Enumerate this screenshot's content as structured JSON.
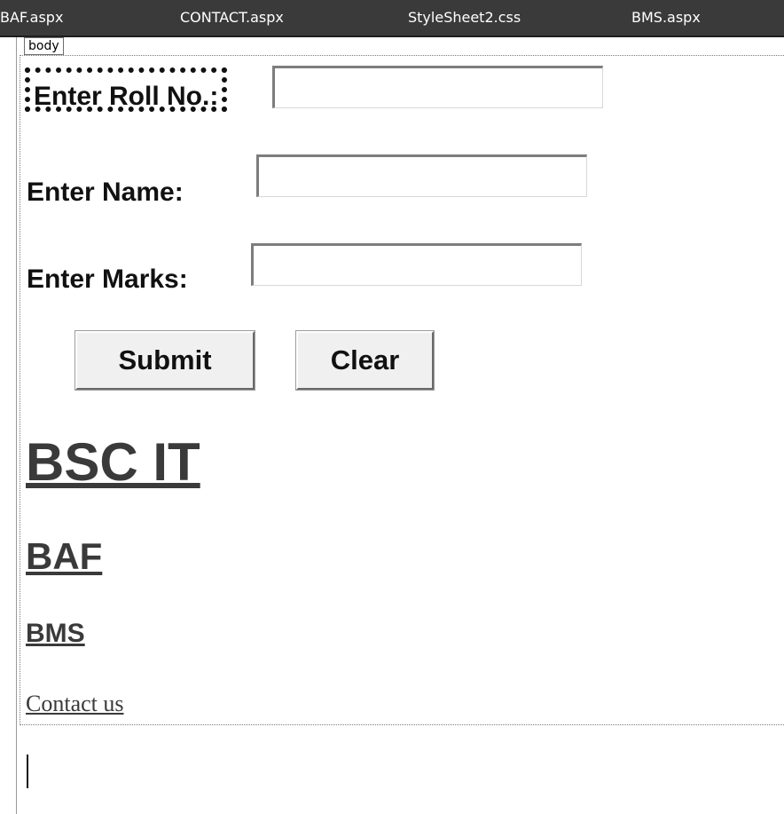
{
  "tabs": [
    {
      "label": "BAF.aspx"
    },
    {
      "label": "CONTACT.aspx"
    },
    {
      "label": "StyleSheet2.css"
    },
    {
      "label": "BMS.aspx"
    }
  ],
  "designer": {
    "body_tag": "body"
  },
  "form": {
    "roll_label": "Enter Roll No.:",
    "roll_value": "",
    "name_label": "Enter Name:",
    "name_value": "",
    "marks_label": "Enter Marks:",
    "marks_value": "",
    "submit_label": "Submit",
    "clear_label": "Clear"
  },
  "links": {
    "bscit": "BSC IT",
    "baf": "BAF",
    "bms": "BMS",
    "contact": "Contact us"
  }
}
